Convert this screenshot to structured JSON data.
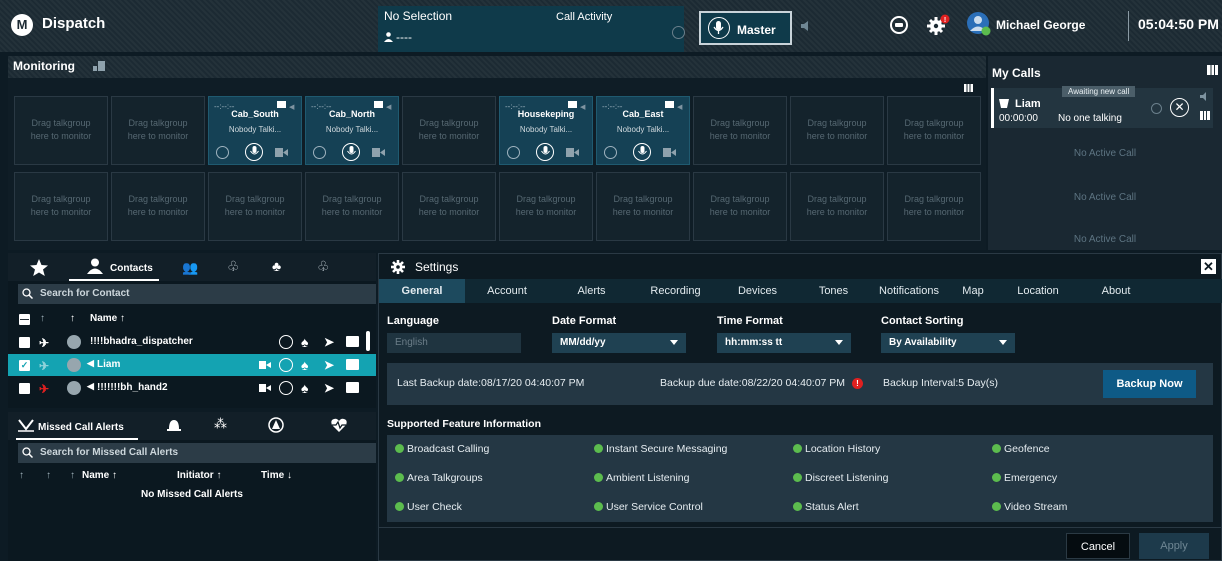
{
  "app": {
    "title": "Dispatch",
    "logo": "motorola-logo"
  },
  "call_panel": {
    "selection": "No Selection",
    "call_activity": "Call Activity",
    "target": "----"
  },
  "master": {
    "label": "Master"
  },
  "user": {
    "name": "Michael George"
  },
  "clock": "05:04:50 PM",
  "monitoring": {
    "title": "Monitoring",
    "placeholder_line1": "Drag talkgroup",
    "placeholder_line2": "here to monitor",
    "active_status": "Nobody Talki...",
    "active_timer": "--:--:--",
    "row1": [
      {
        "name": ""
      },
      {
        "name": ""
      },
      {
        "name": "Cab_South"
      },
      {
        "name": "Cab_North"
      },
      {
        "name": ""
      },
      {
        "name": "Housekeping"
      },
      {
        "name": "Cab_East"
      },
      {
        "name": ""
      },
      {
        "name": ""
      },
      {
        "name": ""
      }
    ]
  },
  "my_calls": {
    "title": "My Calls",
    "awaiting": "Awaiting new call",
    "caller": "Liam",
    "time": "00:00:00",
    "status": "No one talking",
    "no_active": "No Active Call"
  },
  "contacts": {
    "tab_label": "Contacts",
    "search_placeholder": "Search for Contact",
    "column_name": "Name ↑",
    "rows": [
      {
        "name": "!!!!bhadra_dispatcher"
      },
      {
        "name": "Liam"
      },
      {
        "name": "!!!!!!!bh_hand2"
      }
    ]
  },
  "missed": {
    "tab_label": "Missed Call Alerts",
    "search_placeholder": "Search for Missed Call Alerts",
    "col_name": "Name ↑",
    "col_initiator": "Initiator ↑",
    "col_time": "Time ↓",
    "empty": "No Missed Call Alerts"
  },
  "settings": {
    "title": "Settings",
    "tabs": [
      "General",
      "Account",
      "Alerts",
      "Recording",
      "Devices",
      "Tones",
      "Notifications",
      "Map",
      "Location",
      "About"
    ],
    "language_label": "Language",
    "language_value": "English",
    "date_label": "Date Format",
    "date_value": "MM/dd/yy",
    "time_label": "Time Format",
    "time_value": "hh:mm:ss tt",
    "sort_label": "Contact Sorting",
    "sort_value": "By Availability",
    "last_backup": "Last Backup date:08/17/20 04:40:07 PM",
    "backup_due": "Backup due date:08/22/20 04:40:07 PM",
    "backup_interval": "Backup Interval:5 Day(s)",
    "backup_now": "Backup Now",
    "features_title": "Supported Feature Information",
    "features": [
      "Broadcast Calling",
      "Instant Secure Messaging",
      "Location History",
      "Geofence",
      "Area Talkgroups",
      "Ambient Listening",
      "Discreet Listening",
      "Emergency",
      "User Check",
      "User Service Control",
      "Status Alert",
      "Video Stream"
    ],
    "cancel": "Cancel",
    "apply": "Apply"
  },
  "colors": {
    "accent": "#14a3b2",
    "panel": "#1c2a33",
    "active_tile": "#154155",
    "button": "#0e5a86",
    "check": "#5cbc4e",
    "alert": "#e02020"
  }
}
